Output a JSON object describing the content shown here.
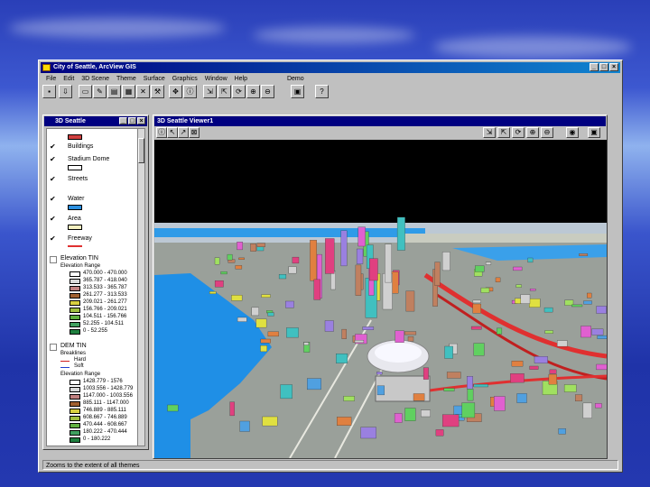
{
  "app": {
    "title": "City of Seattle, ArcView GIS"
  },
  "menu": [
    "File",
    "Edit",
    "3D Scene",
    "Theme",
    "Surface",
    "Graphics",
    "Window",
    "Help",
    "Demo"
  ],
  "project": {
    "title": "3D Seattle",
    "layers": [
      {
        "name": "Buildings",
        "checked": true,
        "color": "#d04040"
      },
      {
        "name": "Stadium Dome",
        "checked": true,
        "color": "#ffffff"
      },
      {
        "name": "Streets",
        "checked": true,
        "color": ""
      },
      {
        "name": "Water",
        "checked": true,
        "color": "#2b8fe0"
      },
      {
        "name": "Area",
        "checked": true,
        "color": "#f4f0c0"
      },
      {
        "name": "Freeway",
        "checked": true,
        "color": "#e03030"
      }
    ],
    "elevation_tin": {
      "name": "Elevation TIN",
      "legend_title": "Elevation Range",
      "ranges": [
        {
          "label": "470.000 - 470.000",
          "color": "#ffffff"
        },
        {
          "label": "365.787 - 418.040",
          "color": "#d8d8d8"
        },
        {
          "label": "313.533 - 365.787",
          "color": "#c08080"
        },
        {
          "label": "261.277 - 313.533",
          "color": "#a06030"
        },
        {
          "label": "209.021 - 261.277",
          "color": "#d8d040"
        },
        {
          "label": "156.766 - 209.021",
          "color": "#a0c040"
        },
        {
          "label": "104.511 - 156.766",
          "color": "#60b040"
        },
        {
          "label": "52.255 - 104.511",
          "color": "#40a060"
        },
        {
          "label": "0 - 52.255",
          "color": "#208040"
        }
      ]
    },
    "dem_tin": {
      "name": "DEM TIN",
      "breaklines_title": "Breaklines",
      "breaklines": [
        {
          "label": "Hard",
          "color": "#d02020"
        },
        {
          "label": "Soft",
          "color": "#2040d0"
        }
      ],
      "legend_title": "Elevation Range",
      "ranges": [
        {
          "label": "1428.779 - 1576",
          "color": "#ffffff"
        },
        {
          "label": "1003.556 - 1428.779",
          "color": "#d8d8d8"
        },
        {
          "label": "1147.000 - 1003.556",
          "color": "#c08080"
        },
        {
          "label": "885.111 - 1147.000",
          "color": "#a06030"
        },
        {
          "label": "746.889 - 885.111",
          "color": "#d8d040"
        },
        {
          "label": "608.667 - 746.889",
          "color": "#a0c040"
        },
        {
          "label": "470.444 - 608.667",
          "color": "#60b040"
        },
        {
          "label": "180.222 - 470.444",
          "color": "#40a060"
        },
        {
          "label": "0 - 180.222",
          "color": "#208040"
        }
      ]
    }
  },
  "viewer": {
    "title": "3D Seattle Viewer1"
  },
  "status": {
    "text": "Zooms to the extent of all themes"
  }
}
